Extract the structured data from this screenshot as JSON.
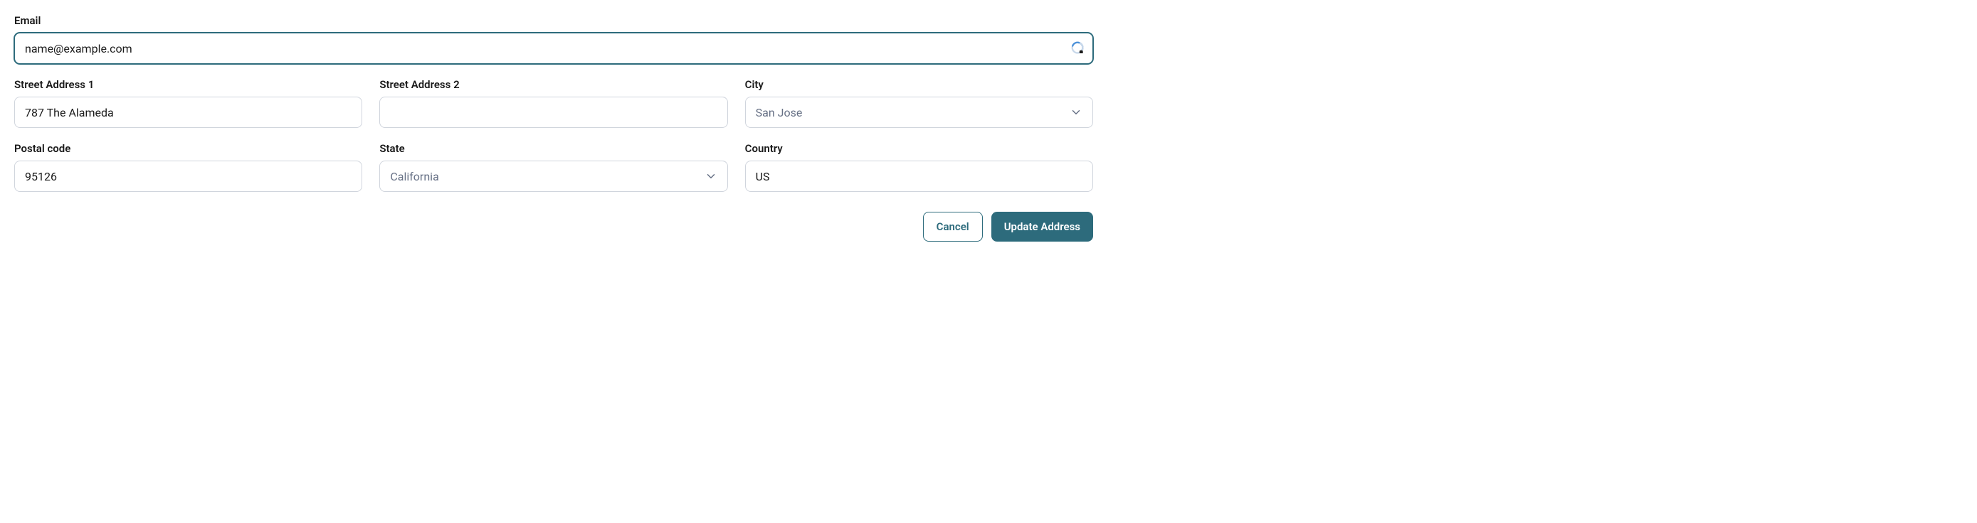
{
  "labels": {
    "email": "Email",
    "street1": "Street Address 1",
    "street2": "Street Address 2",
    "city": "City",
    "postal": "Postal code",
    "state": "State",
    "country": "Country"
  },
  "values": {
    "email": "name@example.com",
    "street1": "787 The Alameda",
    "street2": "",
    "city": "San Jose",
    "postal": "95126",
    "state": "California",
    "country": "US"
  },
  "buttons": {
    "cancel": "Cancel",
    "update": "Update Address"
  }
}
